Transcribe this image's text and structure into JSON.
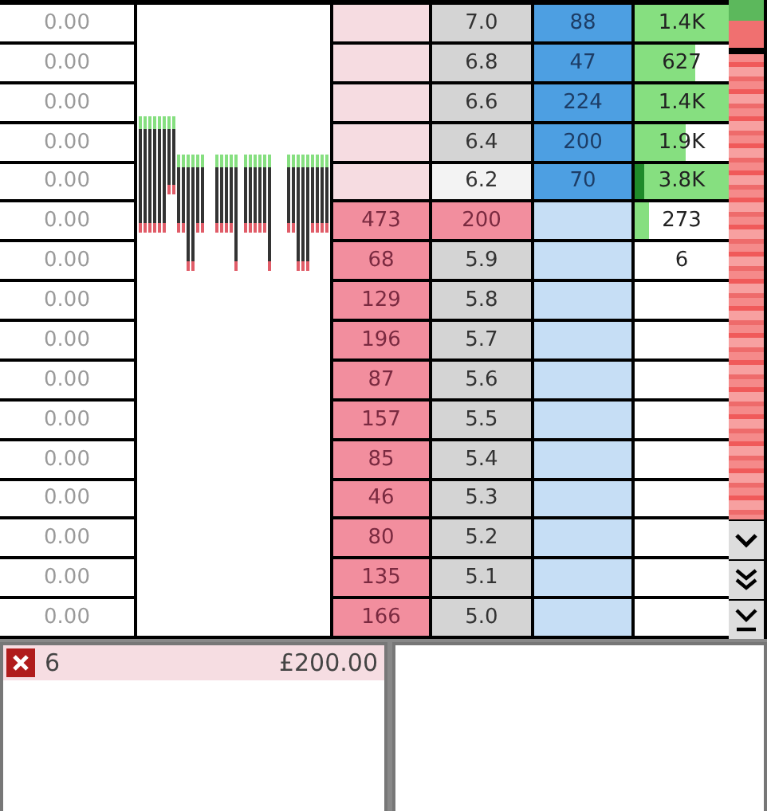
{
  "ladder": {
    "rows": [
      {
        "pl": "0.00",
        "price": "7.0",
        "kind": "price",
        "last_traded": false,
        "back": "88",
        "volume": "1.4K",
        "level": 1
      },
      {
        "pl": "0.00",
        "price": "6.8",
        "kind": "price",
        "last_traded": false,
        "back": "47",
        "volume": "627",
        "level": 0.65
      },
      {
        "pl": "0.00",
        "price": "6.6",
        "kind": "price",
        "last_traded": false,
        "back": "224",
        "volume": "1.4K",
        "level": 1
      },
      {
        "pl": "0.00",
        "price": "6.4",
        "kind": "price",
        "last_traded": false,
        "back": "200",
        "volume": "1.9K",
        "level": 0.55
      },
      {
        "pl": "0.00",
        "price": "6.2",
        "kind": "price",
        "last_traded": true,
        "back": "70",
        "volume": "3.8K",
        "level": 1
      },
      {
        "pl": "0.00",
        "price": "200",
        "kind": "order",
        "last_traded": false,
        "lay": "473",
        "volume": "273",
        "level": 0.15
      },
      {
        "pl": "0.00",
        "price": "5.9",
        "kind": "price",
        "last_traded": false,
        "lay": "68",
        "volume": "6"
      },
      {
        "pl": "0.00",
        "price": "5.8",
        "kind": "price",
        "last_traded": false,
        "lay": "129"
      },
      {
        "pl": "0.00",
        "price": "5.7",
        "kind": "price",
        "last_traded": false,
        "lay": "196"
      },
      {
        "pl": "0.00",
        "price": "5.6",
        "kind": "price",
        "last_traded": false,
        "lay": "87"
      },
      {
        "pl": "0.00",
        "price": "5.5",
        "kind": "price",
        "last_traded": false,
        "lay": "157"
      },
      {
        "pl": "0.00",
        "price": "5.4",
        "kind": "price",
        "last_traded": false,
        "lay": "85"
      },
      {
        "pl": "0.00",
        "price": "5.3",
        "kind": "price",
        "last_traded": false,
        "lay": "46"
      },
      {
        "pl": "0.00",
        "price": "5.2",
        "kind": "price",
        "last_traded": false,
        "lay": "80"
      },
      {
        "pl": "0.00",
        "price": "5.1",
        "kind": "price",
        "last_traded": false,
        "lay": "135"
      },
      {
        "pl": "0.00",
        "price": "5.0",
        "kind": "price",
        "last_traded": false,
        "lay": "166"
      }
    ]
  },
  "unmatched_bets": [
    {
      "selection": "6",
      "stake": "£200.00"
    }
  ]
}
